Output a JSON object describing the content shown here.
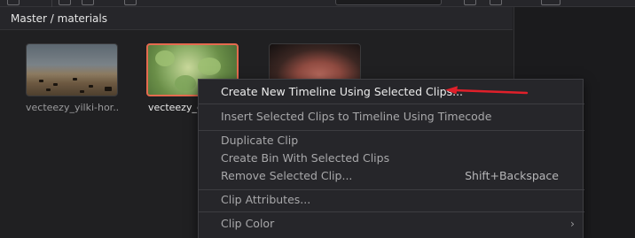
{
  "breadcrumb": "Master / materials",
  "clips": [
    {
      "name": "vecteezy_yilki-hor...",
      "selected": false
    },
    {
      "name": "vecteezy_g",
      "selected": true
    },
    {
      "name": "",
      "selected": false
    }
  ],
  "context_menu": {
    "items": [
      {
        "label": "Create New Timeline Using Selected Clips...",
        "shortcut": ""
      },
      {
        "label": "Insert Selected Clips to Timeline Using Timecode",
        "shortcut": ""
      },
      {
        "label": "Duplicate Clip",
        "shortcut": ""
      },
      {
        "label": "Create Bin With Selected Clips",
        "shortcut": ""
      },
      {
        "label": "Remove Selected Clip...",
        "shortcut": "Shift+Backspace"
      },
      {
        "label": "Clip Attributes...",
        "shortcut": ""
      },
      {
        "label": "Clip Color",
        "shortcut": ""
      }
    ],
    "submenu_glyph": "›"
  },
  "colors": {
    "selection_border": "#e56a4f",
    "annotation_arrow": "#e0202a",
    "menu_background": "#26262a"
  },
  "icons": [
    "chevron-right-icon",
    "annotation-arrow-icon"
  ]
}
